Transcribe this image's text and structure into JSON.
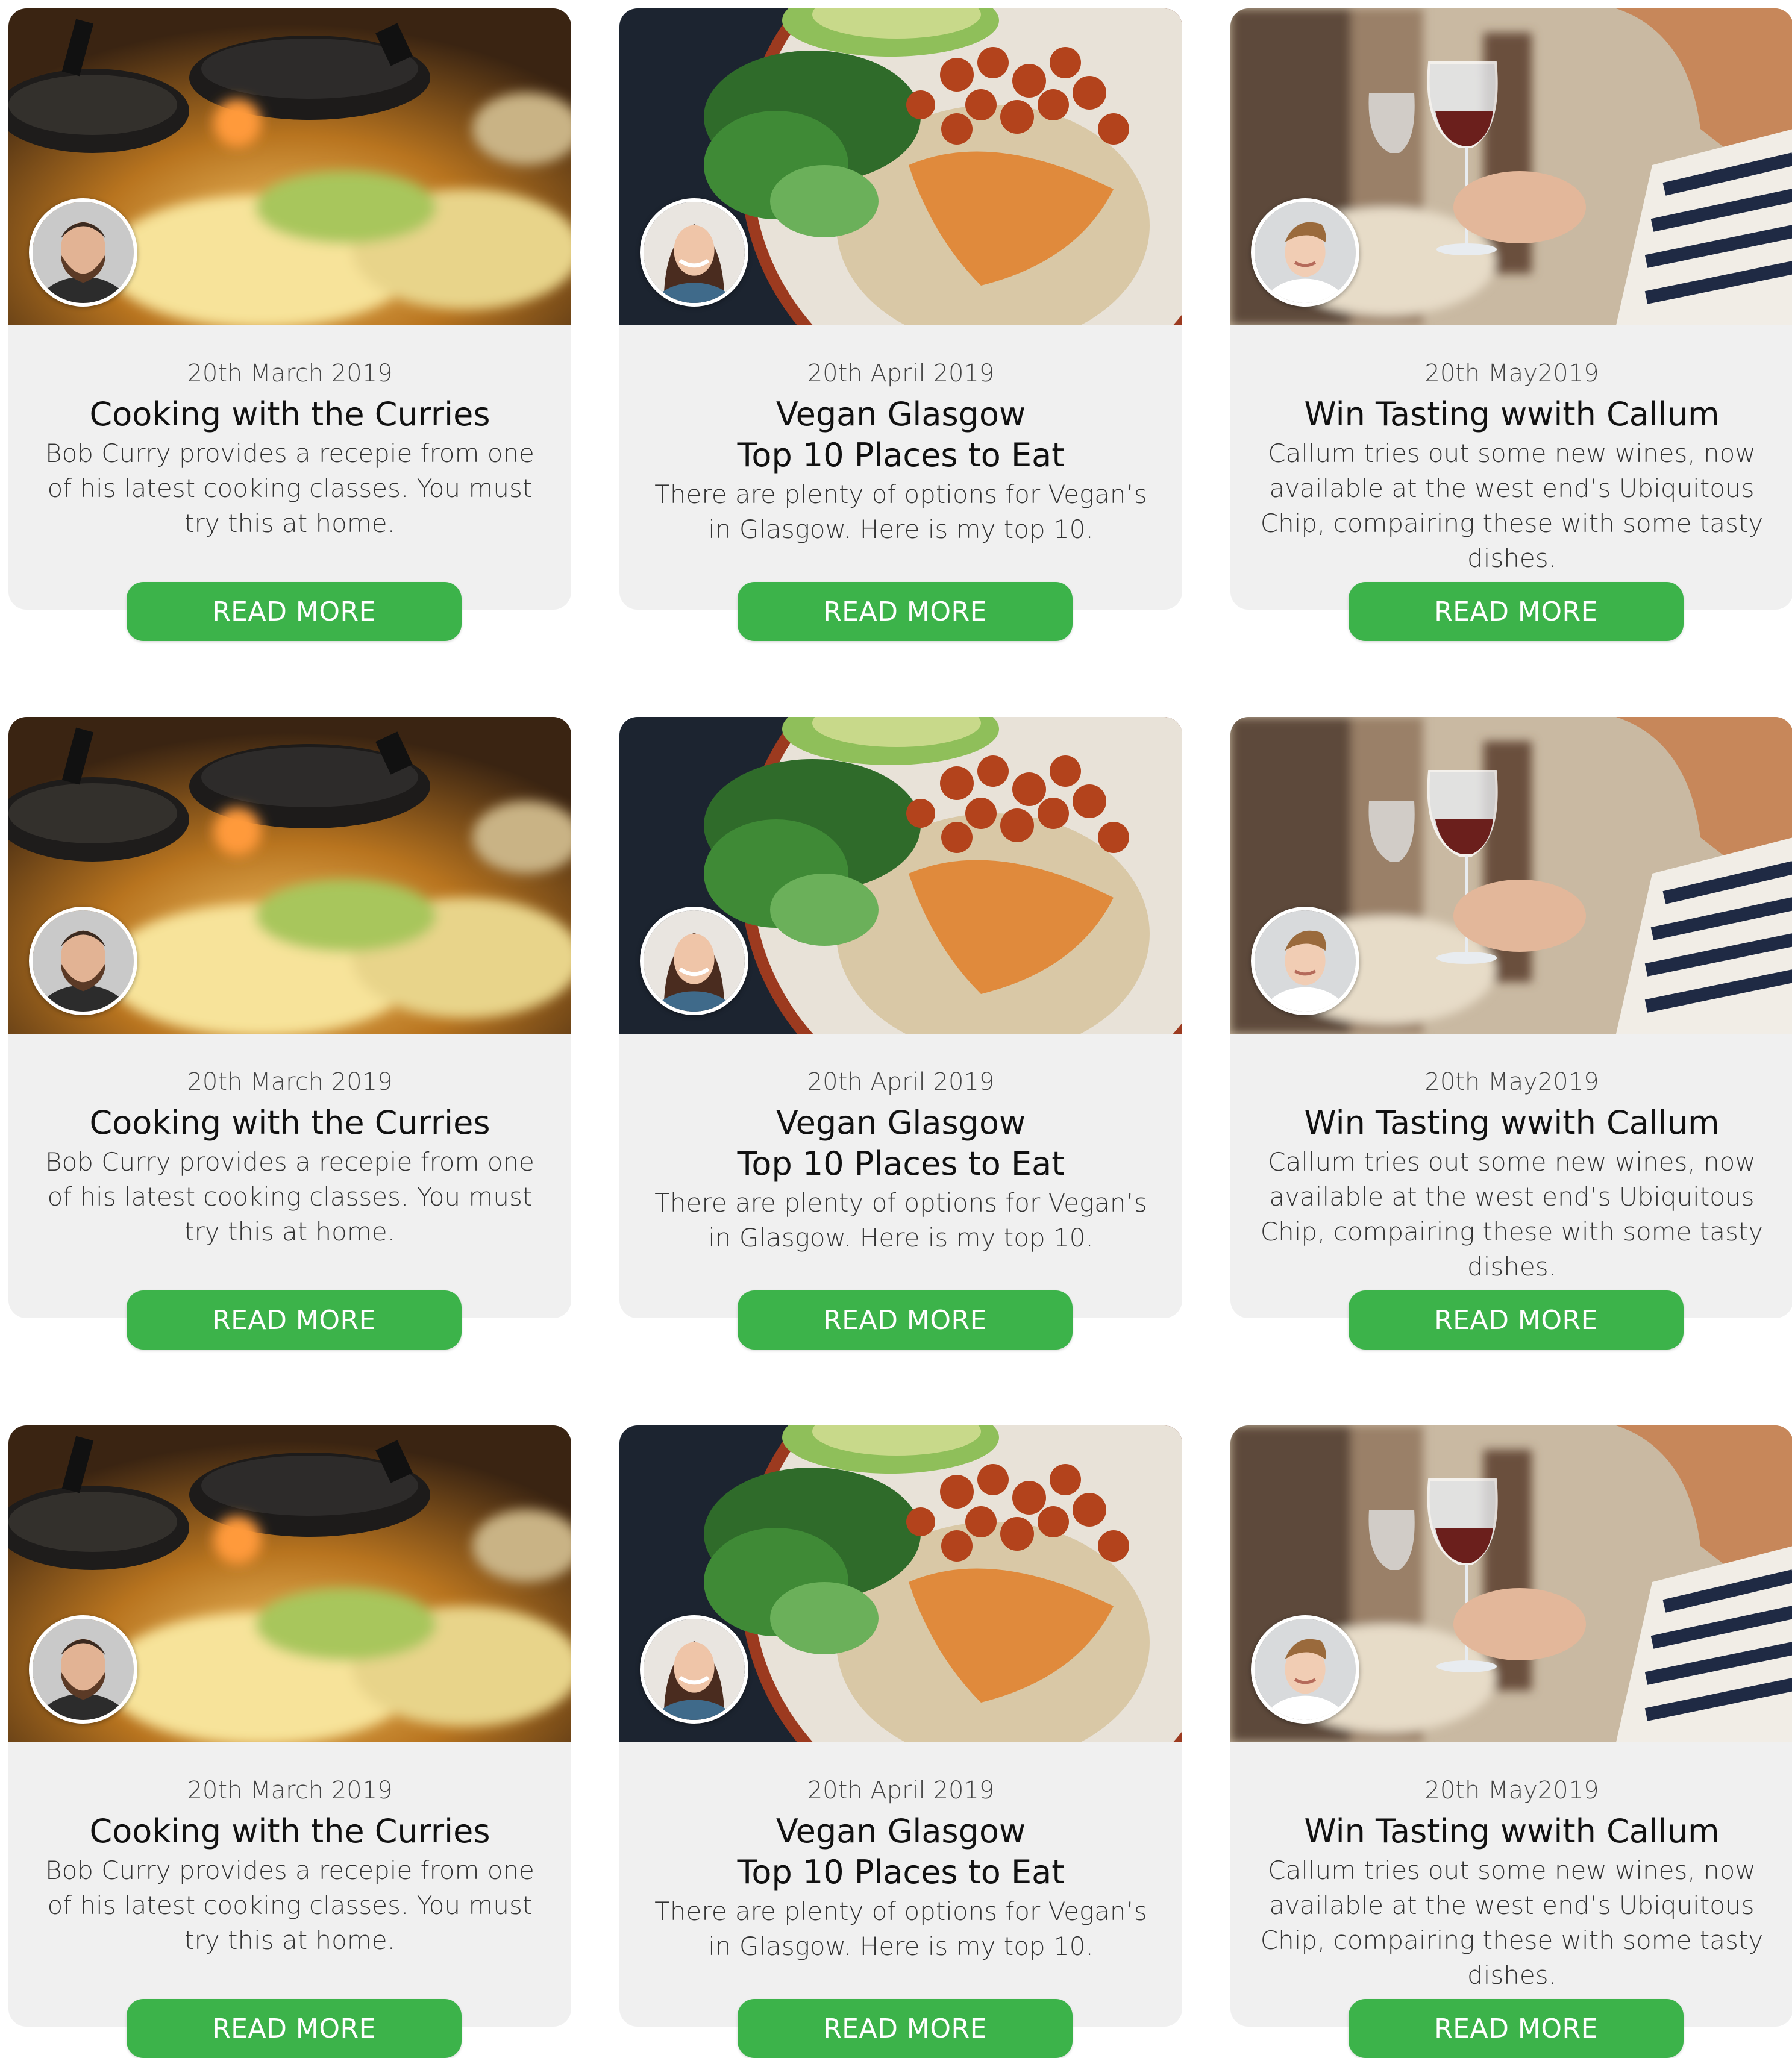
{
  "cards": [
    {
      "type": "cooking",
      "date": "20th March 2019",
      "title_lines": [
        "Cooking with the Curries"
      ],
      "description": "Bob Curry provides a recepie from one of his latest cooking classes. You must try this at home.",
      "button_label": "READ MORE"
    },
    {
      "type": "vegan",
      "date": "20th April 2019",
      "title_lines": [
        "Vegan Glasgow",
        "Top 10 Places to Eat"
      ],
      "description": "There are plenty of options for Vegan’s in Glasgow. Here is my top 10.",
      "button_label": "READ MORE"
    },
    {
      "type": "wine",
      "date": "20th May2019",
      "title_lines": [
        "Win Tasting wwith Callum"
      ],
      "description": "Callum tries out some new wines, now available at the west end’s Ubiquitous Chip, compairing these with some tasty dishes.",
      "button_label": "READ MORE"
    },
    {
      "type": "cooking",
      "date": "20th March 2019",
      "title_lines": [
        "Cooking with the Curries"
      ],
      "description": "Bob Curry provides a recepie from one of his latest cooking classes. You must try this at home.",
      "button_label": "READ MORE"
    },
    {
      "type": "vegan",
      "date": "20th April 2019",
      "title_lines": [
        "Vegan Glasgow",
        "Top 10 Places to Eat"
      ],
      "description": "There are plenty of options for Vegan’s in Glasgow. Here is my top 10.",
      "button_label": "READ MORE"
    },
    {
      "type": "wine",
      "date": "20th May2019",
      "title_lines": [
        "Win Tasting wwith Callum"
      ],
      "description": "Callum tries out some new wines, now available at the west end’s Ubiquitous Chip, compairing these with some tasty dishes.",
      "button_label": "READ MORE"
    },
    {
      "type": "cooking",
      "date": "20th March 2019",
      "title_lines": [
        "Cooking with the Curries"
      ],
      "description": "Bob Curry provides a recepie from one of his latest cooking classes. You must try this at home.",
      "button_label": "READ MORE"
    },
    {
      "type": "vegan",
      "date": "20th April 2019",
      "title_lines": [
        "Vegan Glasgow",
        "Top 10 Places to Eat"
      ],
      "description": "There are plenty of options for Vegan’s in Glasgow. Here is my top 10.",
      "button_label": "READ MORE"
    },
    {
      "type": "wine",
      "date": "20th May2019",
      "title_lines": [
        "Win Tasting wwith Callum"
      ],
      "description": "Callum tries out some new wines, now available at the west end’s Ubiquitous Chip, compairing these with some tasty dishes.",
      "button_label": "READ MORE"
    }
  ],
  "colors": {
    "button": "#3cb34a",
    "card_bg": "#f0f0f0",
    "page_bg": "#ffffff"
  }
}
